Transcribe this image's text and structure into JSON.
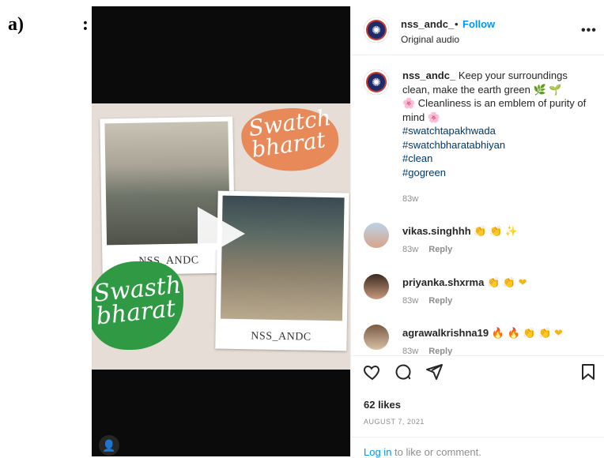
{
  "figure_label": "a)",
  "figure_colon": ":",
  "video": {
    "script_top": "Swatch\nbharat",
    "script_bottom": "Swasth\nbharat",
    "photo1_caption": "NSS_ANDC",
    "photo2_caption": "NSS_ANDC",
    "play_icon": "play-icon"
  },
  "header": {
    "username": "nss_andc_",
    "separator": "•",
    "follow_label": "Follow",
    "subtitle": "Original audio",
    "more_icon": "•••"
  },
  "caption": {
    "username": "nss_andc_",
    "text_line1": "Keep your surroundings clean, make the earth green 🌿 🌱",
    "text_line2": "🌸 Cleanliness is an emblem of purity of mind 🌸",
    "hashtags": [
      "#swatchtapakhwada",
      "#swatchbharatabhiyan",
      "#clean",
      "#gogreen"
    ],
    "age": "83w"
  },
  "comments": [
    {
      "username": "vikas.singhhh",
      "emojis": "👏 👏 ✨",
      "age": "83w",
      "reply_label": "Reply"
    },
    {
      "username": "priyanka.shxrma",
      "emojis": "👏 👏 ❤",
      "age": "83w",
      "reply_label": "Reply"
    },
    {
      "username": "agrawalkrishna19",
      "emojis": "🔥 🔥 👏 👏 ❤",
      "age": "83w",
      "reply_label": "Reply"
    }
  ],
  "actions": {
    "like_icon": "heart-icon",
    "comment_icon": "comment-icon",
    "share_icon": "share-icon",
    "save_icon": "bookmark-icon"
  },
  "likes": "62 likes",
  "date": "AUGUST 7, 2021",
  "login": {
    "link": "Log in",
    "rest": " to like or comment."
  },
  "colors": {
    "accent": "#0095f6",
    "link": "#00376b",
    "muted": "#8e8e8e"
  }
}
